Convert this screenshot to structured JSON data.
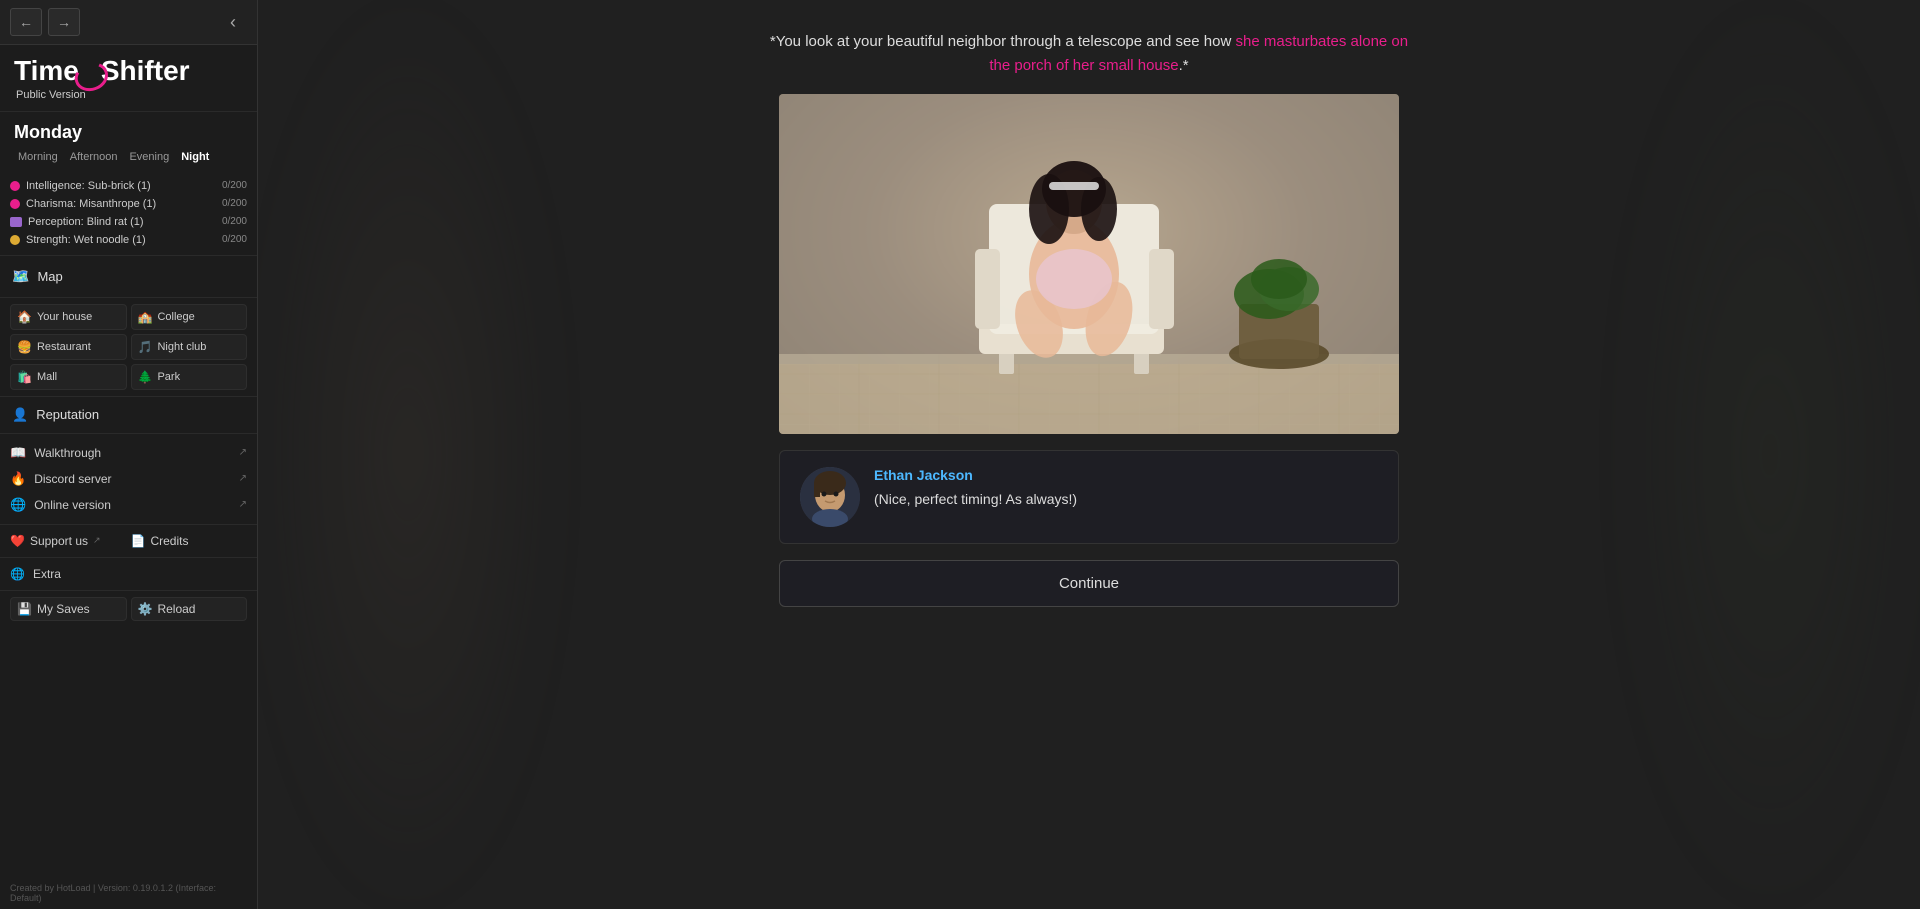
{
  "app": {
    "title": "TimeShifter",
    "subtitle": "Public Version",
    "footer": "Created by HotLoad | Version: 0.19.0.1.2 (Interface: Default)"
  },
  "nav": {
    "back_label": "←",
    "forward_label": "→",
    "collapse_label": "‹"
  },
  "day": {
    "label": "Monday",
    "time_tabs": [
      "Morning",
      "Afternoon",
      "Evening",
      "Night"
    ],
    "active_tab": "Night"
  },
  "stats": [
    {
      "name": "Intelligence: Sub-brick (1)",
      "value": "0/200",
      "color": "#e91e8c"
    },
    {
      "name": "Charisma: Misanthrope (1)",
      "value": "0/200",
      "color": "#e91e8c"
    },
    {
      "name": "Perception: Blind rat (1)",
      "value": "0/200",
      "color": "#aa88cc"
    },
    {
      "name": "Strength: Wet noodle (1)",
      "value": "0/200",
      "color": "#ddaa44"
    }
  ],
  "map": {
    "label": "Map",
    "icon": "🗺️"
  },
  "locations": [
    {
      "name": "Your house",
      "icon": "🏠"
    },
    {
      "name": "College",
      "icon": "🏫"
    },
    {
      "name": "Restaurant",
      "icon": "🍔"
    },
    {
      "name": "Night club",
      "icon": "🎵"
    },
    {
      "name": "Mall",
      "icon": "🛍️"
    },
    {
      "name": "Park",
      "icon": "🌲"
    }
  ],
  "reputation": {
    "label": "Reputation",
    "icon": "👤"
  },
  "links": [
    {
      "name": "Walkthrough",
      "icon": "📖",
      "has_ext": true
    },
    {
      "name": "Discord server",
      "icon": "🔥",
      "has_ext": true
    },
    {
      "name": "Online version",
      "icon": "🌐",
      "has_ext": true
    }
  ],
  "bottom_links": [
    {
      "name": "Support us",
      "icon": "❤️",
      "has_ext": true
    },
    {
      "name": "Credits",
      "icon": "📄",
      "has_ext": false
    }
  ],
  "extra": {
    "label": "Extra",
    "icon": "🌐"
  },
  "saves": [
    {
      "name": "My Saves",
      "icon": "💾"
    },
    {
      "name": "Reload",
      "icon": "⚙️"
    }
  ],
  "narrative": {
    "text_before": "*You look at your beautiful neighbor through a telescope and see how ",
    "text_highlight": "she masturbates alone on the porch of her small house",
    "text_after": ".*"
  },
  "dialogue": {
    "character": "Ethan Jackson",
    "text": "(Nice, perfect timing! As always!)"
  },
  "continue_button": {
    "label": "Continue"
  }
}
